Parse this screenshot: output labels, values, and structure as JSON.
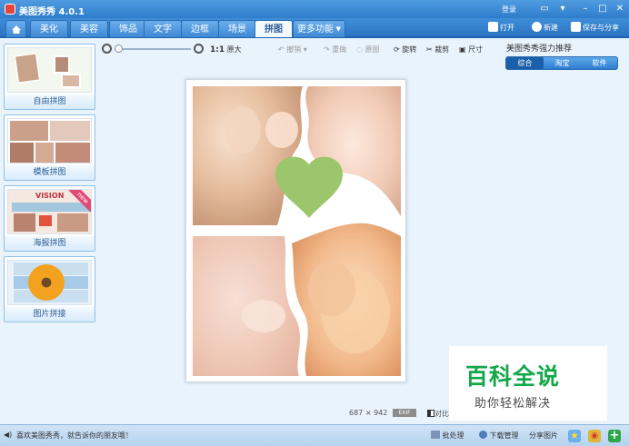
{
  "app": {
    "title": "美图秀秀 4.0.1",
    "login": "登录"
  },
  "nav_tabs": [
    "美化",
    "美容",
    "饰品",
    "文字",
    "边框",
    "场景",
    "拼图",
    "更多功能"
  ],
  "active_tab": "拼图",
  "top_actions": {
    "open": "打开",
    "new": "新建",
    "save": "保存与分享"
  },
  "toolbar": {
    "zoom_original": "原大",
    "zoom_ratio": "1:1",
    "undo": "撤销",
    "redo": "重做",
    "reset": "原图",
    "rotate": "旋转",
    "crop": "裁剪",
    "size": "尺寸"
  },
  "recommend": {
    "title": "美图秀秀强力推荐",
    "tabs": [
      "综合",
      "淘宝",
      "软件"
    ],
    "active": "综合"
  },
  "templates": [
    {
      "label": "自由拼图",
      "icon": "free-collage-icon"
    },
    {
      "label": "模板拼图",
      "icon": "template-collage-icon"
    },
    {
      "label": "海报拼图",
      "icon": "poster-collage-icon",
      "poster_text": "VISION",
      "badge": "new"
    },
    {
      "label": "图片拼接",
      "icon": "image-join-icon"
    }
  ],
  "image_info": {
    "width": "687",
    "times": "×",
    "height": "942",
    "exif": "EXIF",
    "compare": "对比"
  },
  "status": {
    "message": "喜欢美图秀秀，就告诉你的朋友哦！",
    "batch": "批处理",
    "download": "下载管理",
    "share": "分享图片"
  },
  "watermark": {
    "brand": "百科全说",
    "tagline": "助你轻松解决"
  },
  "colors": {
    "title_blue": "#2f7dcc",
    "heart_green": "#9cc66b",
    "watermark_green": "#12a84a"
  }
}
